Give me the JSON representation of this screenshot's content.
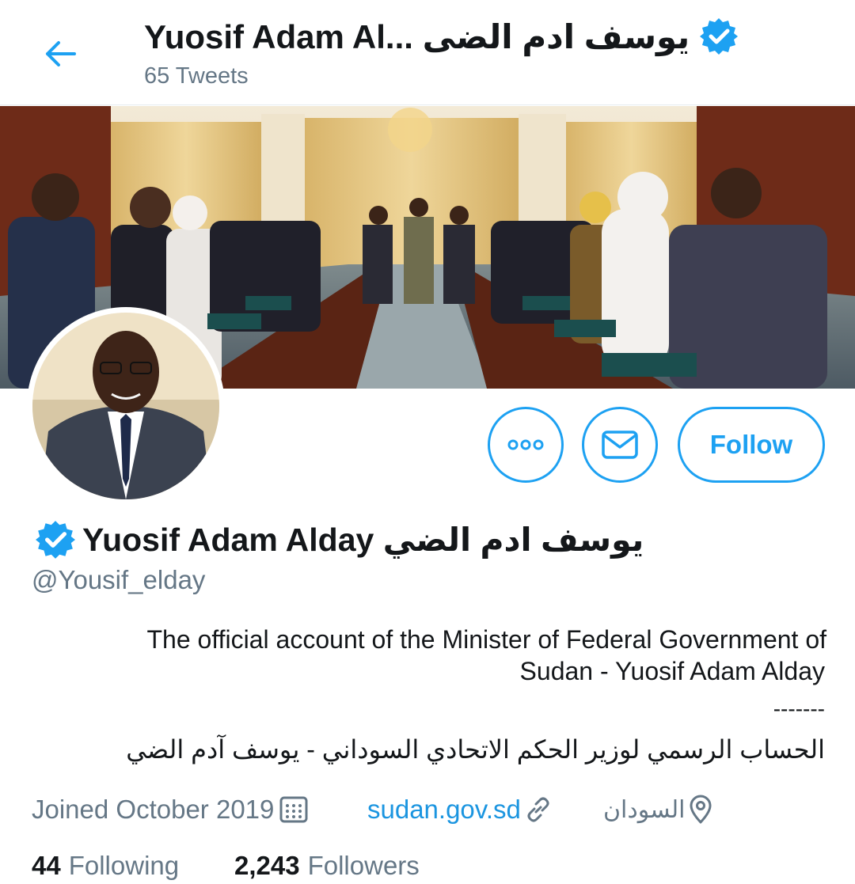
{
  "header": {
    "title": "Yuosif Adam Al... يوسف ادم الضى",
    "tweet_count": "65 Tweets"
  },
  "actions": {
    "follow_label": "Follow"
  },
  "profile": {
    "display_name": "Yuosif Adam Alday يوسف ادم الضي",
    "handle": "@Yousif_elday",
    "bio_en_line1": "The official account of the Minister of Federal Government of",
    "bio_en_line2": "Sudan - Yuosif Adam Alday",
    "bio_separator": "-------",
    "bio_ar": "الحساب الرسمي لوزير الحكم الاتحادي السوداني - يوسف آدم الضي",
    "joined": "Joined October 2019",
    "website": "sudan.gov.sd",
    "location": "السودان"
  },
  "stats": {
    "following_count": "44",
    "following_label": "Following",
    "followers_count": "2,243",
    "followers_label": "Followers"
  },
  "colors": {
    "accent": "#1da1f2",
    "secondary_text": "#657786",
    "primary_text": "#14171a"
  }
}
